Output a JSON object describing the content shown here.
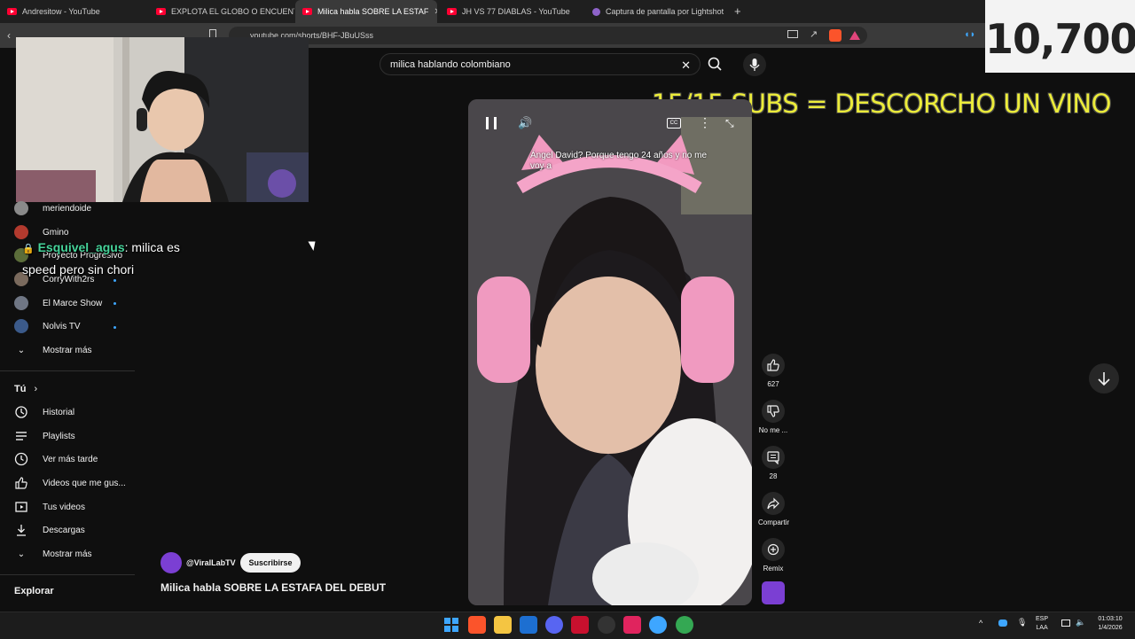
{
  "browser": {
    "tabs": [
      {
        "label": "Andresitow - YouTube",
        "active": false
      },
      {
        "label": "EXPLOTA EL GLOBO O ENCUENTRA E",
        "active": false
      },
      {
        "label": "Milica habla SOBRE LA ESTAF",
        "active": true
      },
      {
        "label": "JH VS 77 DIABLAS - YouTube",
        "active": false
      },
      {
        "label": "Captura de pantalla por Lightshot",
        "active": false
      }
    ],
    "url": "youtube.com/shorts/BHF-JBuUSss"
  },
  "stream_overlay": {
    "counter": "10,700",
    "subs_goal": "15/15 SUBS = DESCORCHO UN VINO",
    "chat": {
      "user": "Esquivel_agus",
      "message_line1": ": milica es",
      "message_line2": "speed pero sin chori"
    }
  },
  "search": {
    "value": "milica hablando colombiano"
  },
  "sidebar": {
    "subscriptions": [
      {
        "label": "meriendoide",
        "live": false
      },
      {
        "label": "Gmino",
        "live": false
      },
      {
        "label": "Proyecto Progresivo",
        "live": false
      },
      {
        "label": "CorryWith2rs",
        "live": true
      },
      {
        "label": "El Marce Show",
        "live": true
      },
      {
        "label": "Nolvis TV",
        "live": true
      }
    ],
    "show_more_1": "Mostrar más",
    "you_header": "Tú",
    "you_items": [
      {
        "label": "Historial",
        "icon": "history-icon"
      },
      {
        "label": "Playlists",
        "icon": "playlists-icon"
      },
      {
        "label": "Ver más tarde",
        "icon": "watch-later-icon"
      },
      {
        "label": "Videos que me gus...",
        "icon": "liked-icon"
      },
      {
        "label": "Tus videos",
        "icon": "your-videos-icon"
      },
      {
        "label": "Descargas",
        "icon": "downloads-icon"
      }
    ],
    "show_more_2": "Mostrar más",
    "explore_header": "Explorar"
  },
  "video": {
    "caption": "Ángel David? Porque tengo 24 años y no me voy a",
    "channel": "@ViralLabTV",
    "subscribe": "Suscribirse",
    "title": "Milica habla SOBRE LA ESTAFA DEL DEBUT"
  },
  "actions": {
    "likes": "627",
    "dislike": "No me ...",
    "comments": "28",
    "share": "Compartir",
    "remix": "Remix"
  },
  "taskbar": {
    "lang1": "ESP",
    "lang2": "LAA",
    "time": "01:03:10",
    "date": "1/4/2026"
  },
  "colors": {
    "accent_live": "#3ea6ff",
    "subs_text": "#ecec3a",
    "chat_username": "#46d39a",
    "youtube_red": "#ff0033"
  }
}
